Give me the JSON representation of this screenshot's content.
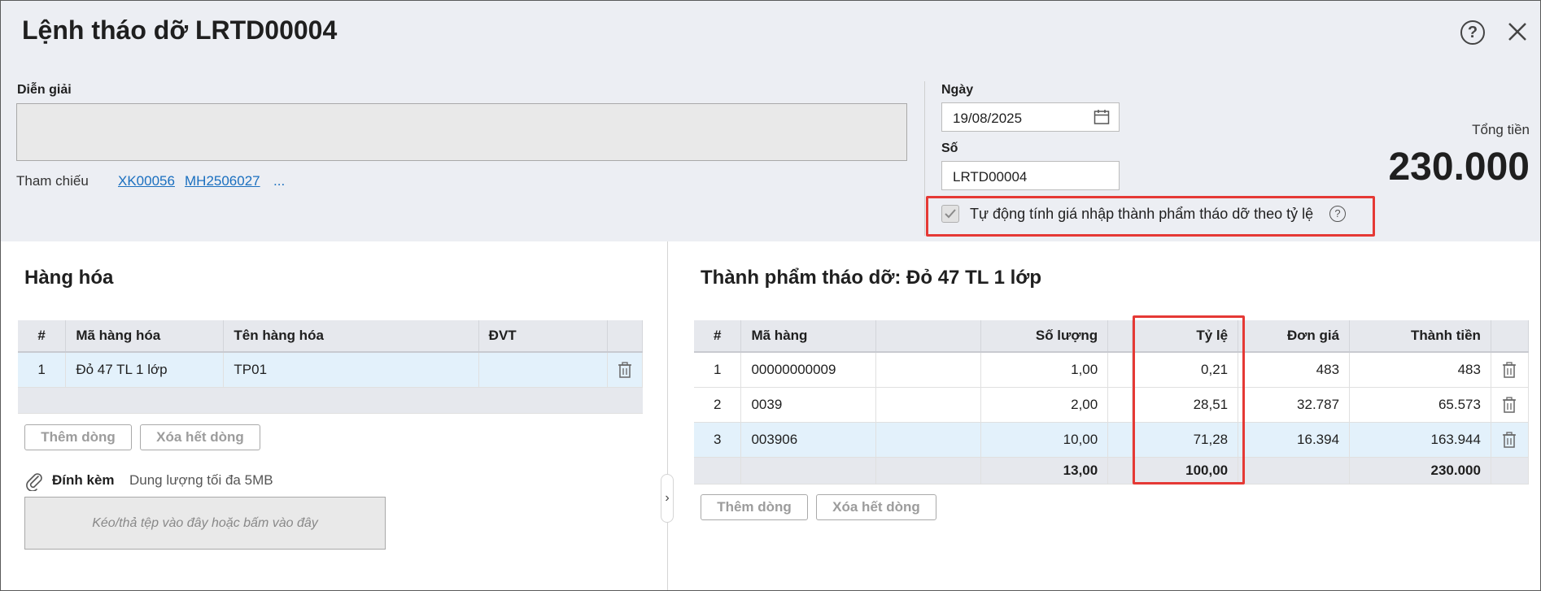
{
  "header": {
    "title": "Lệnh tháo dỡ LRTD00004",
    "help_icon": "question-circle-icon",
    "close_icon": "close-icon"
  },
  "form": {
    "description_label": "Diễn giải",
    "description_value": "",
    "reference_label": "Tham chiếu",
    "references": [
      "XK00056",
      "MH2506027"
    ],
    "more_refs": "...",
    "date_label": "Ngày",
    "date_value": "19/08/2025",
    "number_label": "Số",
    "number_value": "LRTD00004",
    "auto_price_label": "Tự động tính giá nhập thành phẩm tháo dỡ theo tỷ lệ",
    "auto_price_checked": true,
    "total_label": "Tổng tiền",
    "total_value": "230.000"
  },
  "goods": {
    "title": "Hàng hóa",
    "columns": [
      "#",
      "Mã hàng hóa",
      "Tên hàng hóa",
      "ĐVT"
    ],
    "rows": [
      {
        "no": "1",
        "code": "Đỏ 47 TL 1 lớp",
        "name": "TP01",
        "unit": ""
      }
    ],
    "add_row_label": "Thêm dòng",
    "clear_rows_label": "Xóa hết dòng"
  },
  "attachment": {
    "label": "Đính kèm",
    "hint": "Dung lượng tối đa 5MB",
    "dropzone_text": "Kéo/thả tệp vào đây hoặc bấm vào đây"
  },
  "products": {
    "title": "Thành phẩm tháo dỡ: Đỏ 47 TL 1 lớp",
    "columns": [
      "#",
      "Mã hàng",
      "",
      "Số lượng",
      "",
      "Tỷ lệ",
      "Đơn giá",
      "Thành tiền"
    ],
    "rows": [
      {
        "no": "1",
        "code": "00000000009",
        "qty": "1,00",
        "ratio": "0,21",
        "price": "483",
        "amount": "483"
      },
      {
        "no": "2",
        "code": "0039",
        "qty": "2,00",
        "ratio": "28,51",
        "price": "32.787",
        "amount": "65.573"
      },
      {
        "no": "3",
        "code": "003906",
        "qty": "10,00",
        "ratio": "71,28",
        "price": "16.394",
        "amount": "163.944"
      }
    ],
    "totals": {
      "qty": "13,00",
      "ratio": "100,00",
      "amount": "230.000"
    },
    "add_row_label": "Thêm dòng",
    "clear_rows_label": "Xóa hết dòng"
  },
  "colors": {
    "highlight": "#e53935",
    "link": "#1a6fbf",
    "header_bg": "#eceef3",
    "selected_row": "#e3f1fb"
  }
}
